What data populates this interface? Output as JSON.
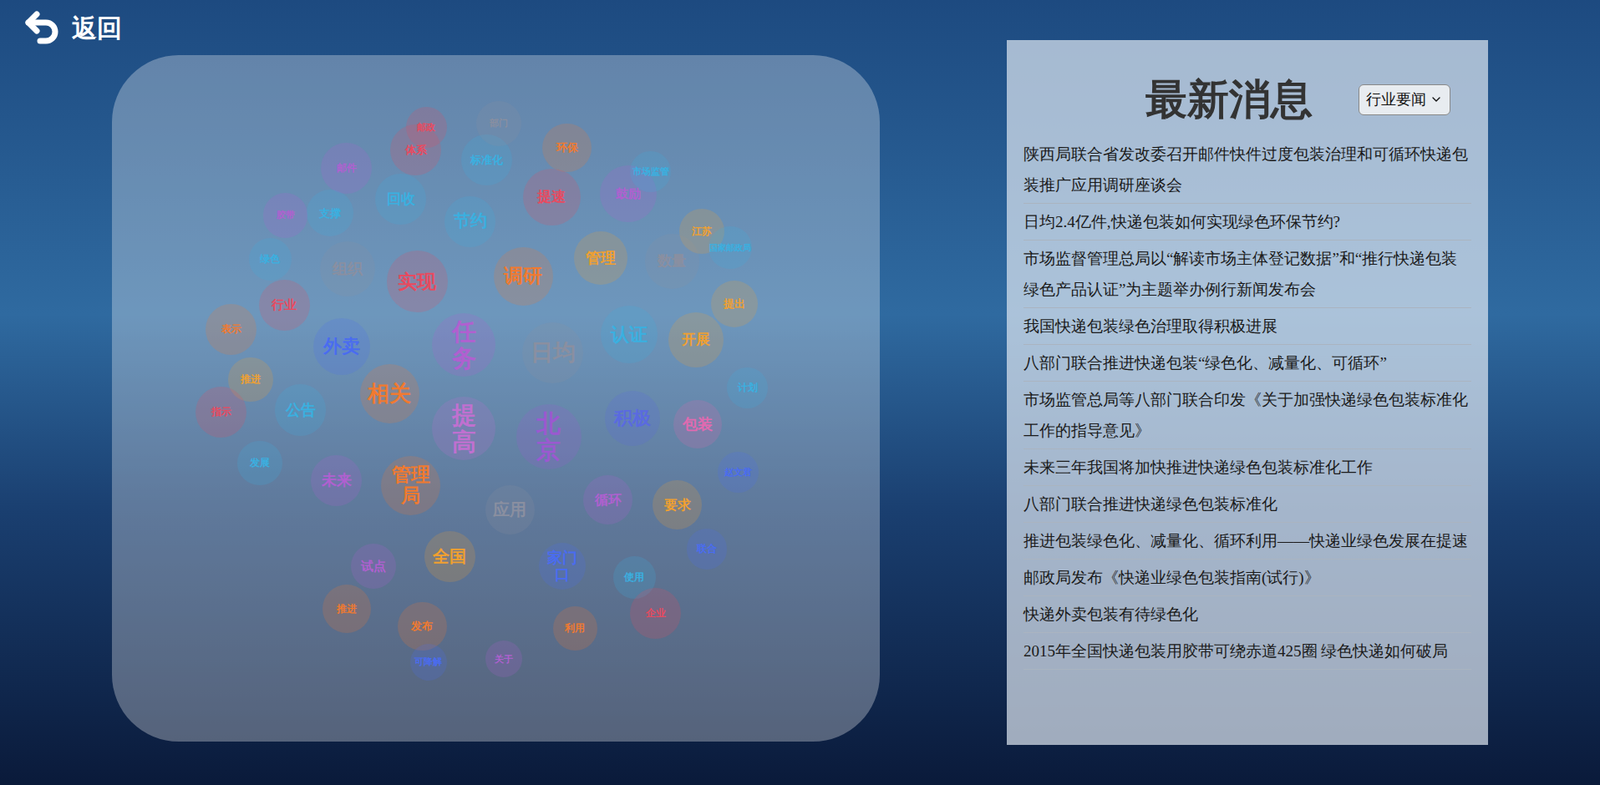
{
  "back": {
    "label": "返回"
  },
  "news": {
    "title": "最新消息",
    "category": "行业要闻",
    "items": [
      "陕西局联合省发改委召开邮件快件过度包装治理和可循环快递包装推广应用调研座谈会",
      "日均2.4亿件,快递包装如何实现绿色环保节约?",
      "市场监督管理总局以“解读市场主体登记数据”和“推行快递包装绿色产品认证”为主题举办例行新闻发布会",
      "我国快递包装绿色治理取得积极进展",
      "八部门联合推进快递包装“绿色化、减量化、可循环”",
      "市场监管总局等八部门联合印发《关于加强快递绿色包装标准化工作的指导意见》",
      "未来三年我国将加快推进快递绿色包装标准化工作",
      "八部门联合推进快递绿色包装标准化",
      "推进包装绿色化、减量化、循环利用——快递业绿色发展在提速",
      "邮政局发布《快递业绿色包装指南(试行)》",
      "快递外卖包装有待绿色化",
      "2015年全国快递包装用胶带可绕赤道425圈 绿色快递如何破局"
    ]
  },
  "word_cloud": [
    {
      "text": "任务",
      "color": "#b060d0",
      "kind": "vertical"
    },
    {
      "text": "提高",
      "color": "#c070d0",
      "kind": "vertical"
    },
    {
      "text": "北京",
      "color": "#9b59d0",
      "kind": "vertical"
    },
    {
      "text": "日均",
      "color": "#8a8fa0",
      "kind": "horizontal"
    },
    {
      "text": "实现",
      "color": "#e84a5f",
      "kind": "horizontal"
    },
    {
      "text": "调研",
      "color": "#f07a30",
      "kind": "horizontal"
    },
    {
      "text": "相关",
      "color": "#f07a30",
      "kind": "horizontal"
    },
    {
      "text": "管理局",
      "color": "#f07a30",
      "kind": "wrap"
    },
    {
      "text": "外卖",
      "color": "#4a6cf0",
      "kind": "horizontal"
    },
    {
      "text": "认证",
      "color": "#3ab0e0",
      "kind": "horizontal"
    },
    {
      "text": "开展",
      "color": "#f0a030",
      "kind": "horizontal"
    },
    {
      "text": "积极",
      "color": "#5a6ae0",
      "kind": "horizontal"
    },
    {
      "text": "包装",
      "color": "#e06ab0",
      "kind": "horizontal"
    },
    {
      "text": "组织",
      "color": "#8a8fa0",
      "kind": "horizontal"
    },
    {
      "text": "管理",
      "color": "#f0a030",
      "kind": "horizontal"
    },
    {
      "text": "数量",
      "color": "#8a8fa0",
      "kind": "horizontal"
    },
    {
      "text": "节约",
      "color": "#3ab0e0",
      "kind": "horizontal"
    },
    {
      "text": "回收",
      "color": "#3ab0e0",
      "kind": "horizontal"
    },
    {
      "text": "提速",
      "color": "#e84a5f",
      "kind": "horizontal"
    },
    {
      "text": "鼓励",
      "color": "#b060d0",
      "kind": "horizontal"
    },
    {
      "text": "体系",
      "color": "#e84a5f",
      "kind": "horizontal"
    },
    {
      "text": "标准化",
      "color": "#3ab0e0",
      "kind": "horizontal"
    },
    {
      "text": "环保",
      "color": "#f07a30",
      "kind": "horizontal"
    },
    {
      "text": "邮件",
      "color": "#b060d0",
      "kind": "horizontal"
    },
    {
      "text": "支撑",
      "color": "#3ab0e0",
      "kind": "horizontal"
    },
    {
      "text": "胶带",
      "color": "#b060d0",
      "kind": "horizontal"
    },
    {
      "text": "行业",
      "color": "#e84a5f",
      "kind": "horizontal"
    },
    {
      "text": "表示",
      "color": "#f07a30",
      "kind": "horizontal"
    },
    {
      "text": "公告",
      "color": "#3ab0e0",
      "kind": "horizontal"
    },
    {
      "text": "推进",
      "color": "#f0a030",
      "kind": "horizontal"
    },
    {
      "text": "指示",
      "color": "#e84a5f",
      "kind": "horizontal"
    },
    {
      "text": "未来",
      "color": "#b060d0",
      "kind": "horizontal"
    },
    {
      "text": "发展",
      "color": "#3ab0e0",
      "kind": "horizontal"
    },
    {
      "text": "全国",
      "color": "#f0a030",
      "kind": "horizontal"
    },
    {
      "text": "家门口",
      "color": "#4a6cf0",
      "kind": "wrap"
    },
    {
      "text": "要求",
      "color": "#f0a030",
      "kind": "horizontal"
    },
    {
      "text": "应用",
      "color": "#8a8fa0",
      "kind": "horizontal"
    },
    {
      "text": "联合",
      "color": "#4a6cf0",
      "kind": "horizontal"
    },
    {
      "text": "推进",
      "color": "#f07a30",
      "kind": "horizontal"
    },
    {
      "text": "发布",
      "color": "#f07a30",
      "kind": "horizontal"
    },
    {
      "text": "利用",
      "color": "#f07a30",
      "kind": "horizontal"
    },
    {
      "text": "可降解",
      "color": "#4a6cf0",
      "kind": "horizontal"
    },
    {
      "text": "关于",
      "color": "#b060d0",
      "kind": "horizontal"
    },
    {
      "text": "提出",
      "color": "#f0a030",
      "kind": "horizontal"
    },
    {
      "text": "江苏",
      "color": "#f0a030",
      "kind": "horizontal"
    },
    {
      "text": "市场监管",
      "color": "#3ab0e0",
      "kind": "horizontal"
    },
    {
      "text": "国家邮政局",
      "color": "#3ab0e0",
      "kind": "horizontal"
    },
    {
      "text": "计划",
      "color": "#3ab0e0",
      "kind": "horizontal"
    },
    {
      "text": "赵文君",
      "color": "#4a6cf0",
      "kind": "horizontal"
    },
    {
      "text": "绿色",
      "color": "#3ab0e0",
      "kind": "horizontal"
    },
    {
      "text": "试点",
      "color": "#b060d0",
      "kind": "horizontal"
    },
    {
      "text": "循环",
      "color": "#b060d0",
      "kind": "horizontal"
    },
    {
      "text": "使用",
      "color": "#3ab0e0",
      "kind": "horizontal"
    },
    {
      "text": "企业",
      "color": "#e84a5f",
      "kind": "horizontal"
    },
    {
      "text": "邮政",
      "color": "#e84a5f",
      "kind": "horizontal"
    },
    {
      "text": "部门",
      "color": "#8a8fa0",
      "kind": "horizontal"
    }
  ]
}
